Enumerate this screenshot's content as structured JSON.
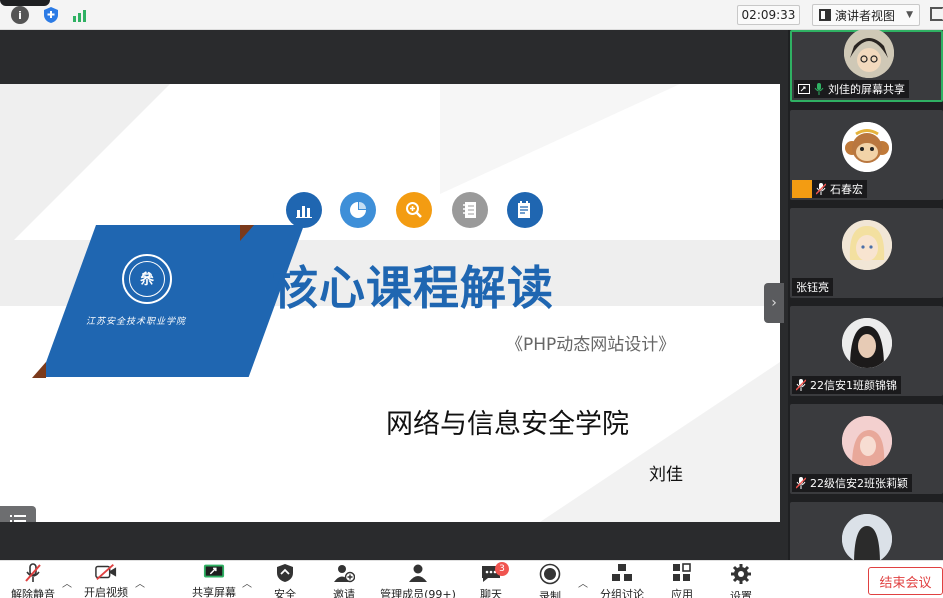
{
  "topbar": {
    "timer": "02:09:33",
    "view_mode": "演讲者视图"
  },
  "slide": {
    "title": "核心课程解读",
    "subtitle": "《PHP动态网站设计》",
    "college": "网络与信息安全学院",
    "author": "刘佳",
    "logo_text": "江苏安全技术职业学院",
    "accent_color": "#1f66b1"
  },
  "participants": [
    {
      "name": "刘佳的屏幕共享",
      "mic": "on",
      "active": true
    },
    {
      "name": "石春宏",
      "mic": "off",
      "active": false
    },
    {
      "name": "张钰亮",
      "mic": "none",
      "active": false
    },
    {
      "name": "22信安1班颜锦锦",
      "mic": "off",
      "active": false
    },
    {
      "name": "22级信安2班张莉颖",
      "mic": "off",
      "active": false
    }
  ],
  "toolbar": {
    "unmute": "解除静音",
    "start_video": "开启视频",
    "share_screen": "共享屏幕",
    "security": "安全",
    "invite": "邀请",
    "manage_members": "管理成员(99+)",
    "chat": "聊天",
    "chat_badge": "3",
    "record": "录制",
    "breakout": "分组讨论",
    "apps": "应用",
    "settings": "设置",
    "end_meeting": "结束会议"
  }
}
